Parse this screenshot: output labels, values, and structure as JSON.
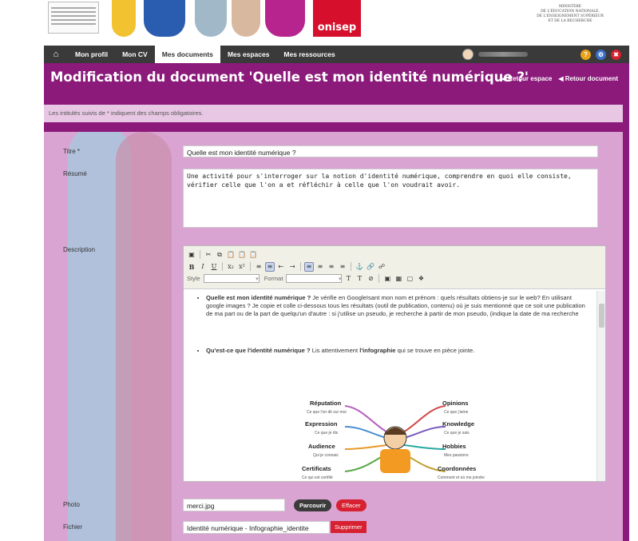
{
  "header": {
    "logo_text": "onisep",
    "ministry_lines": [
      "MINISTÈRE",
      "DE L'ÉDUCATION NATIONALE,",
      "DE L'ENSEIGNEMENT SUPÉRIEUR",
      "ET DE LA RECHERCHE"
    ]
  },
  "nav": {
    "items": [
      "Mon profil",
      "Mon CV",
      "Mes documents",
      "Mes espaces",
      "Mes ressources"
    ],
    "active_index": 2
  },
  "page": {
    "title": "Modification du document 'Quelle est mon identité numérique ?'",
    "back_space": "Retour espace",
    "back_document": "Retour document",
    "mandatory_note": "Les intitulés suivis de * indiquent des champs obligatoires."
  },
  "form": {
    "title_label": "Titre *",
    "title_value": "Quelle est mon identité numérique ?",
    "summary_label": "Résumé",
    "summary_value": "Une activité pour s'interroger sur la notion d'identité numérique, comprendre en quoi elle consiste, vérifier celle que l'on a et réfléchir à celle que l'on voudrait avoir.",
    "description_label": "Description",
    "photo_label": "Photo",
    "photo_value": "merci.jpg",
    "browse_label": "Parcourir",
    "clear_label": "Effacer",
    "file_label": "Fichier",
    "file_value": "Identité numérique - Infographie_identite",
    "delete_label": "Supprimer"
  },
  "editor": {
    "style_label": "Style",
    "format_label": "Format",
    "bullet1_bold": "Quelle est mon identité numérique ?",
    "bullet1_text": " Je vérifie en GoogleIsant mon nom et prénom : quels résultats obtiens-je sur le web? En utilisant google images ? Je copie et colle ci-dessous tous les résultats (outil de publication, contenu) où je suis mentionné que ce soit une publication de ma part ou de la part de quelqu'un d'autre : si j'utilise un pseudo, je recherche à partir de mon pseudo, (indique la date de ma recherche",
    "bullet2_bold": "Qu'est-ce que l'identité numérique ?",
    "bullet2_text_a": " Lis attentivement ",
    "bullet2_bold_b": "l'infographie",
    "bullet2_text_c": " qui se trouve en pièce jointe.",
    "infographic": {
      "left": [
        {
          "label": "Réputation",
          "sub": "Ce que l'on dit sur moi"
        },
        {
          "label": "Expression",
          "sub": "Ce que je dis"
        },
        {
          "label": "Audience",
          "sub": "Qui je connais"
        },
        {
          "label": "Certificats",
          "sub": "Ce qui est certifié"
        }
      ],
      "right": [
        {
          "label": "Opinions",
          "sub": "Ce que j'aime"
        },
        {
          "label": "Knowledge",
          "sub": "Ce que je sais"
        },
        {
          "label": "Hobbies",
          "sub": "Mes passions"
        },
        {
          "label": "Coordonnées",
          "sub": "Comment et où me joindre"
        }
      ]
    }
  },
  "colors": {
    "purple": "#8b1a7a",
    "panel": "#d9a3d2",
    "navbar": "#3a3a3a",
    "red": "#d72030"
  }
}
